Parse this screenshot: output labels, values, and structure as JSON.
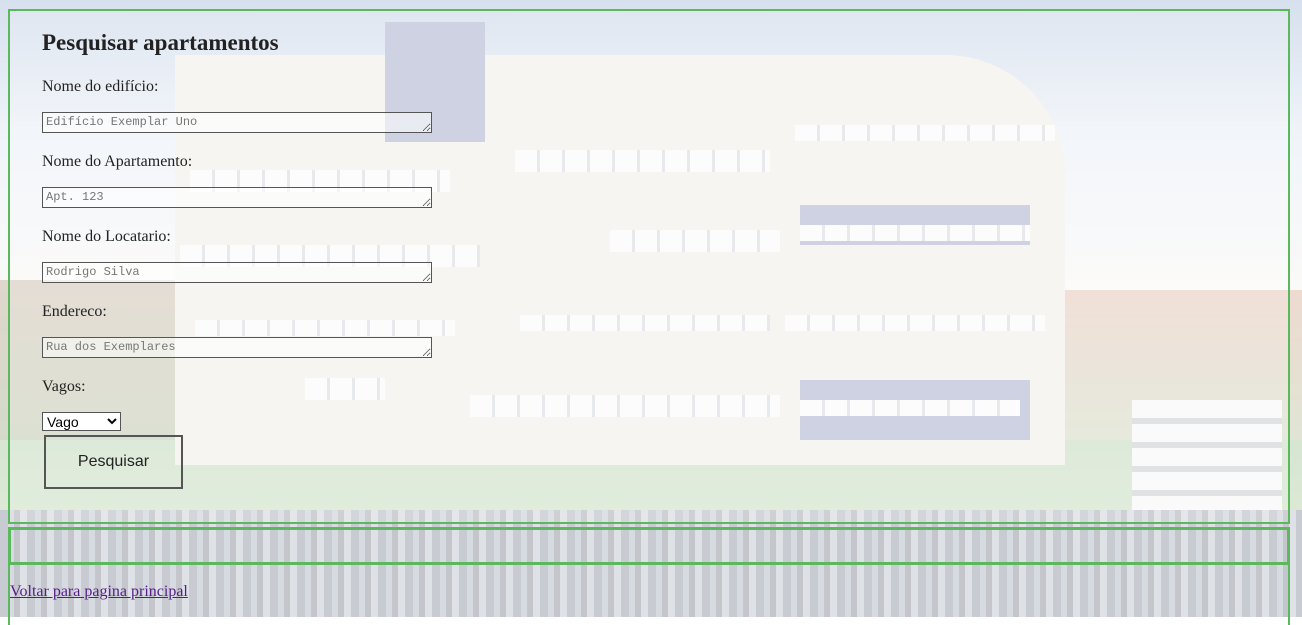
{
  "form": {
    "title": "Pesquisar apartamentos",
    "building_label": "Nome do edifício:",
    "building_placeholder": "Edifício Exemplar Uno",
    "apartment_label": "Nome do Apartamento:",
    "apartment_placeholder": "Apt. 123",
    "tenant_label": "Nome do Locatario:",
    "tenant_placeholder": "Rodrigo Silva",
    "address_label": "Endereco:",
    "address_placeholder": "Rua dos Exemplares",
    "vacancy_label": "Vagos:",
    "vacancy_selected": "Vago",
    "search_button": "Pesquisar"
  },
  "footer": {
    "back_link": "Voltar para pagina principal"
  },
  "colors": {
    "border_accent": "#5cb85c",
    "link_visited": "#551a8b"
  }
}
